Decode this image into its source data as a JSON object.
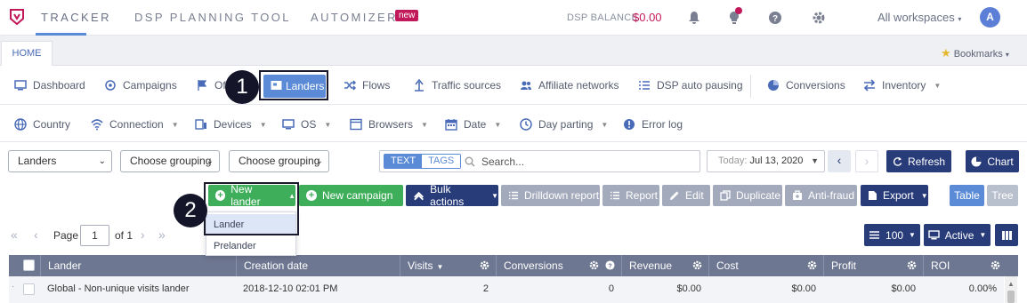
{
  "topnav": {
    "items": [
      "TRACKER",
      "DSP PLANNING TOOL",
      "AUTOMIZER"
    ],
    "new_badge": "new",
    "dsp_balance_label": "DSP BALANCE",
    "dsp_balance_value": "$0.00",
    "workspaces": "All workspaces",
    "avatar_letter": "A",
    "accent_color": "#5b8bd6",
    "brand_color": "#c2195a"
  },
  "tabbar": {
    "home": "HOME",
    "bookmarks": "Bookmarks"
  },
  "nav_primary": [
    {
      "label": "Dashboard",
      "icon": "monitor-icon"
    },
    {
      "label": "Campaigns",
      "icon": "target-icon"
    },
    {
      "label": "Of",
      "icon": "flag-icon"
    },
    {
      "label": "Landers",
      "icon": "lander-icon"
    },
    {
      "label": "Flows",
      "icon": "shuffle-icon"
    },
    {
      "label": "Traffic sources",
      "icon": "traffic-source-icon"
    },
    {
      "label": "Affiliate networks",
      "icon": "users-icon"
    },
    {
      "label": "DSP auto pausing",
      "icon": "list-icon"
    },
    {
      "label": "Conversions",
      "icon": "pie-icon"
    },
    {
      "label": "Inventory",
      "icon": "swap-icon"
    }
  ],
  "nav_secondary": [
    {
      "label": "Country",
      "icon": "globe-icon"
    },
    {
      "label": "Connection",
      "icon": "wifi-icon"
    },
    {
      "label": "Devices",
      "icon": "devices-icon"
    },
    {
      "label": "OS",
      "icon": "desktop-icon"
    },
    {
      "label": "Browsers",
      "icon": "browser-icon"
    },
    {
      "label": "Date",
      "icon": "calendar-icon"
    },
    {
      "label": "Day parting",
      "icon": "clock-icon"
    },
    {
      "label": "Error log",
      "icon": "error-icon"
    }
  ],
  "filters": {
    "entity": "Landers",
    "grouping1": "Choose grouping",
    "grouping2": "Choose grouping",
    "search_mode_text": "TEXT",
    "search_mode_tags": "TAGS",
    "search_placeholder": "Search...",
    "date_label": "Today:",
    "date_value": "Jul 13, 2020",
    "refresh": "Refresh",
    "chart": "Chart"
  },
  "actions": {
    "new_lander": "New lander",
    "new_campaign": "New campaign",
    "bulk_actions": "Bulk actions",
    "drilldown_report": "Drilldown report",
    "report": "Report",
    "edit": "Edit",
    "duplicate": "Duplicate",
    "anti_fraud": "Anti-fraud",
    "export": "Export",
    "table": "Table",
    "tree": "Tree"
  },
  "dropdown": {
    "items": [
      "Lander",
      "Prelander"
    ]
  },
  "callouts": [
    "1",
    "2"
  ],
  "pagination": {
    "page_label": "Page",
    "page_value": "1",
    "of_label": "of 1",
    "per_page": "100",
    "status": "Active"
  },
  "table": {
    "columns": [
      "Lander",
      "Creation date",
      "Visits",
      "Conversions",
      "Revenue",
      "Cost",
      "Profit",
      "ROI"
    ],
    "rows": [
      {
        "lander": "Global - Non-unique visits lander",
        "creation_date": "2018-12-10 02:01 PM",
        "visits": "2",
        "conversions": "0",
        "revenue": "$0.00",
        "cost": "$0.00",
        "profit": "$0.00",
        "roi": "0.00%"
      }
    ]
  }
}
